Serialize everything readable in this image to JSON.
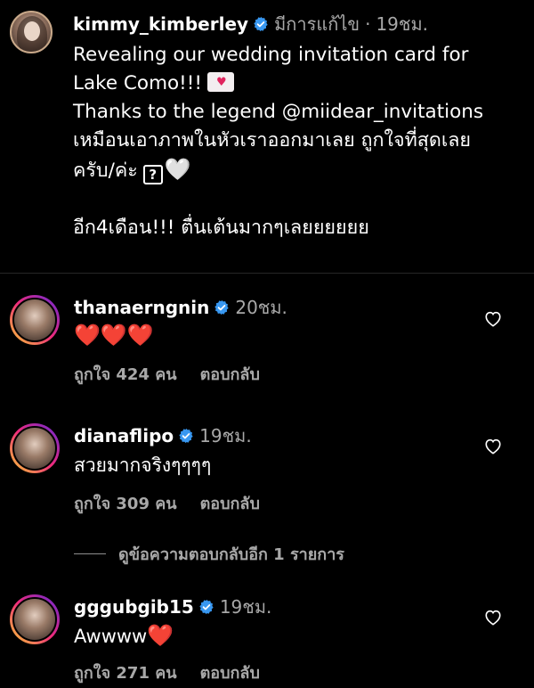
{
  "post": {
    "username": "kimmy_kimberley",
    "edited_label": "มีการแก้ไข",
    "separator": "·",
    "time": "19ชม.",
    "caption_lines": [
      "Revealing our wedding invitation card for",
      "Lake Como!!!",
      "Thanks to the legend @miidear_invitations",
      "เหมือนเอาภาพในหัวเราออกมาเลย ถูกใจที่สุดเลย",
      "ครับ/ค่ะ",
      "อีก4เดือน!!! ตื่นเต้นมากๆเลยยยยยย"
    ],
    "box_glyph": "?",
    "white_heart": "🤍"
  },
  "comments": [
    {
      "username": "thanaerngnin",
      "time": "20ชม.",
      "text": "",
      "hearts": "❤️❤️❤️",
      "likes": "ถูกใจ 424 คน",
      "reply_label": "ตอบกลับ"
    },
    {
      "username": "dianaflipo",
      "time": "19ชม.",
      "text": "สวยมากจริงๆๆๆๆ",
      "likes": "ถูกใจ 309 คน",
      "reply_label": "ตอบกลับ",
      "view_replies": "ดูข้อความตอบกลับอีก 1 รายการ"
    },
    {
      "username": "gggubgib15",
      "time": "19ชม.",
      "text": "Awwww",
      "heart": "❤️",
      "likes": "ถูกใจ 271 คน",
      "reply_label": "ตอบกลับ"
    }
  ],
  "colors": {
    "background": "#000000",
    "secondary_text": "#a8a8a8",
    "verified_blue": "#3897f0",
    "heart_red": "#ed4956"
  },
  "icons": {
    "verified": "verified-badge-icon",
    "like": "heart-outline-icon"
  }
}
